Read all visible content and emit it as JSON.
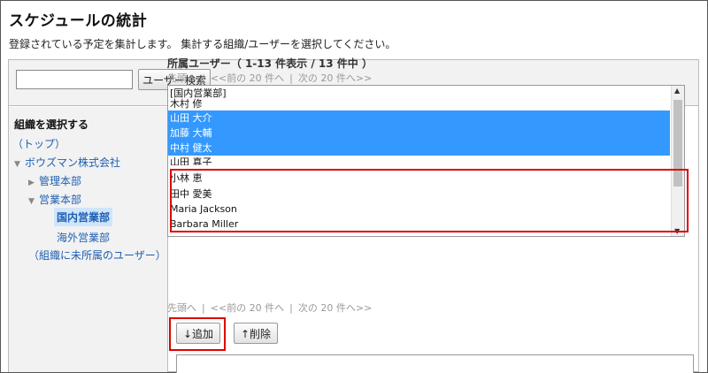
{
  "page": {
    "title": "スケジュールの統計",
    "description": "登録されている予定を集計します。 集計する組織/ユーザーを選択してください。"
  },
  "search": {
    "input_value": "",
    "button_label": "ユーザー検索"
  },
  "tree": {
    "heading": "組織を選択する",
    "top_label": "（トップ）",
    "company": "ボウズマン株式会社",
    "dept_admin": "管理本部",
    "dept_sales": "営業本部",
    "dept_domestic": "国内営業部",
    "dept_overseas": "海外営業部",
    "unassigned": "（組織に未所属のユーザー）"
  },
  "users": {
    "heading": "所属ユーザー（ 1-13 件表示 / 13 件中 ）",
    "pager": {
      "first": "先頭へ",
      "prev": "<<前の 20 件へ",
      "next": "次の 20 件へ>>"
    },
    "items": [
      "[国内営業部]",
      "木村 修",
      "山田 大介",
      "加藤 大輔",
      "中村 健太",
      "山田 真子",
      "小林 恵",
      "田中 愛美",
      "Maria Jackson",
      "Barbara Miller"
    ]
  },
  "actions": {
    "add_label": "↓追加",
    "remove_label": "↑削除"
  },
  "colors": {
    "selection": "#3399ff",
    "highlight_box": "#e00000",
    "link": "#1e5fb3"
  }
}
